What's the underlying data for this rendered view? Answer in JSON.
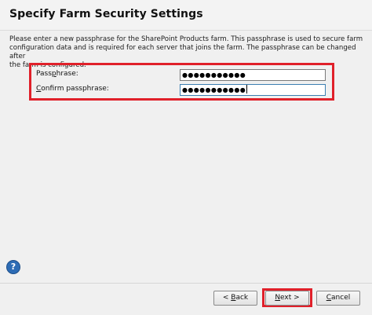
{
  "page": {
    "title": "Specify Farm Security Settings",
    "description": "Please enter a new passphrase for the SharePoint Products farm. This passphrase is used to secure farm\nconfiguration data and is required for each server that joins the farm. The passphrase can be changed after\nthe farm is configured."
  },
  "form": {
    "passphrase_label_pre": "Pass",
    "passphrase_label_accel": "p",
    "passphrase_label_post": "hrase:",
    "passphrase_value": "●●●●●●●●●●●",
    "confirm_label_accel": "C",
    "confirm_label_post": "onfirm passphrase:",
    "confirm_value": "●●●●●●●●●●●"
  },
  "footer": {
    "help_glyph": "?",
    "back_pre": "< ",
    "back_accel": "B",
    "back_post": "ack",
    "next_accel": "N",
    "next_post": "ext  >",
    "cancel_accel": "C",
    "cancel_post": "ancel"
  },
  "colors": {
    "highlight": "#e0202a",
    "focus_border": "#3c7fb1",
    "help_blue": "#2d6cb5"
  }
}
